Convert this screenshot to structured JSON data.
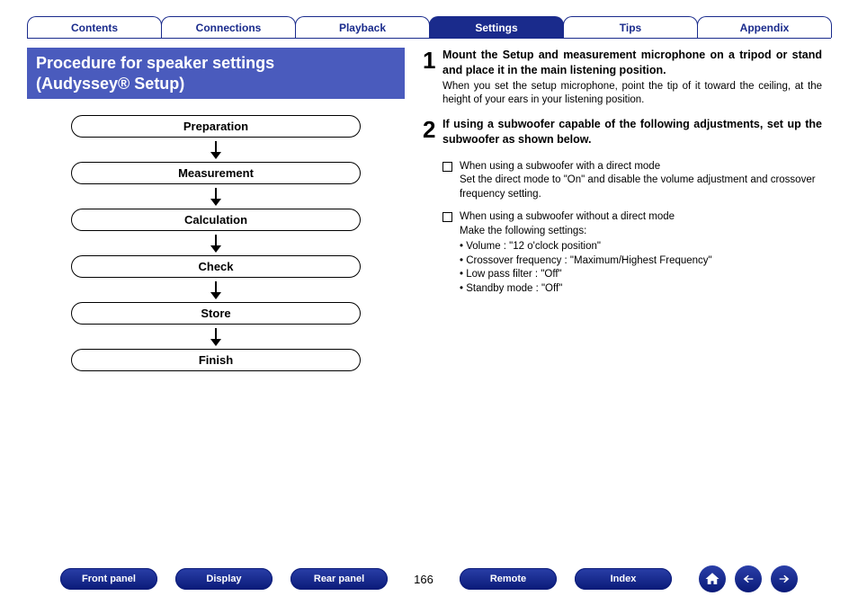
{
  "tabs": {
    "items": [
      {
        "label": "Contents"
      },
      {
        "label": "Connections"
      },
      {
        "label": "Playback"
      },
      {
        "label": "Settings",
        "active": true
      },
      {
        "label": "Tips"
      },
      {
        "label": "Appendix"
      }
    ]
  },
  "section_title_line1": "Procedure for speaker settings",
  "section_title_line2": "(Audyssey® Setup)",
  "flow": [
    "Preparation",
    "Measurement",
    "Calculation",
    "Check",
    "Store",
    "Finish"
  ],
  "steps": {
    "s1": {
      "num": "1",
      "bold": "Mount the Setup and measurement microphone on a tripod or stand and place it in the main listening position.",
      "desc": "When you set the setup microphone, point the tip of it toward the ceiling, at the height of your ears in your listening position."
    },
    "s2": {
      "num": "2",
      "bold": "If using a subwoofer capable of the following adjustments, set up the subwoofer as shown below."
    }
  },
  "sub": {
    "a": {
      "title": "When using a subwoofer with a direct mode",
      "text": "Set the direct mode to \"On\" and disable the volume adjustment and crossover frequency setting."
    },
    "b": {
      "title": "When using a subwoofer without a direct mode",
      "lead": "Make the following settings:",
      "b1": "Volume : \"12 o'clock position\"",
      "b2": "Crossover frequency : \"Maximum/Highest Frequency\"",
      "b3": "Low pass filter : \"Off\"",
      "b4": "Standby mode : \"Off\""
    }
  },
  "bottom": {
    "front_panel": "Front panel",
    "display": "Display",
    "rear_panel": "Rear panel",
    "remote": "Remote",
    "index": "Index",
    "page_num": "166"
  }
}
